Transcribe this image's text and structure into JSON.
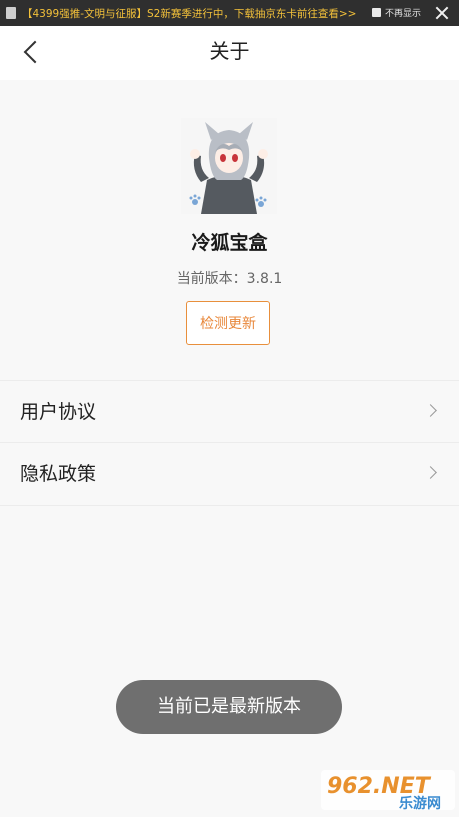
{
  "ad_banner": {
    "text": "【4399强推-文明与征服】S2新赛季进行中，下载抽京东卡前往查看>>",
    "no_show_label": "不再显示"
  },
  "header": {
    "title": "关于"
  },
  "app": {
    "name": "冷狐宝盒",
    "version_text": "当前版本：3.8.1",
    "check_update_label": "检测更新"
  },
  "menu": {
    "items": [
      {
        "label": "用户协议"
      },
      {
        "label": "隐私政策"
      }
    ]
  },
  "toast": {
    "message": "当前已是最新版本"
  },
  "watermark": {
    "brand": "962.NET",
    "sub": "乐游网"
  },
  "colors": {
    "accent": "#e8873a",
    "ad_text": "#f3c13a",
    "toast_bg": "#6f6f6f"
  }
}
